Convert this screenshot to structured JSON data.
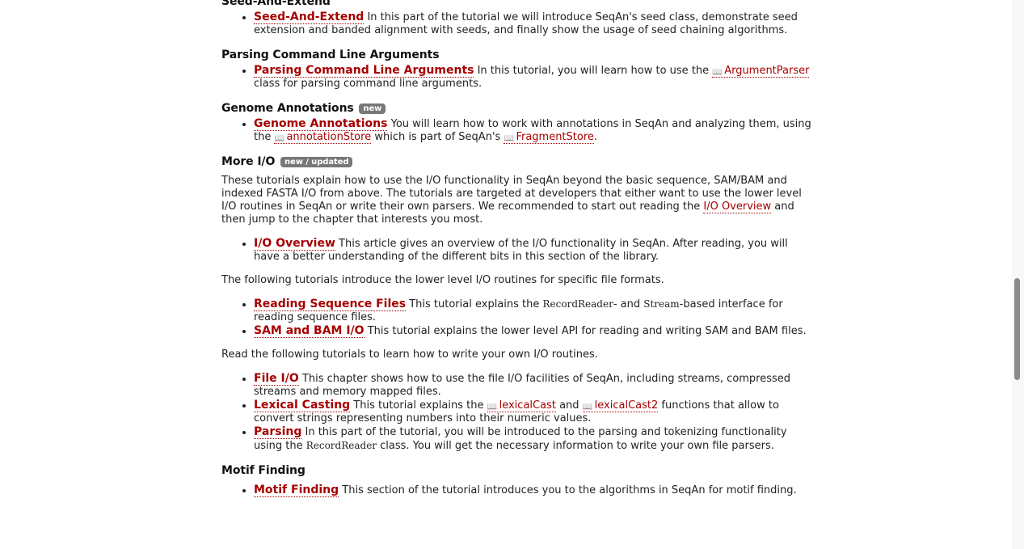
{
  "sections": {
    "seed": {
      "heading": "Seed-And-Extend",
      "item_link": "Seed-And-Extend",
      "item_text": " In this part of the tutorial we will introduce SeqAn's seed class, demonstrate seed extension and banded alignment with seeds, and finally show the usage of seed chaining algorithms."
    },
    "parsing_cli": {
      "heading": "Parsing Command Line Arguments",
      "item_link": "Parsing Command Line Arguments",
      "item_text_1": " In this tutorial, you will learn how to use the ",
      "dox_link": "ArgumentParser",
      "item_text_2": " class for parsing command line arguments."
    },
    "genome": {
      "heading": "Genome Annotations",
      "badge": "new",
      "item_link": "Genome Annotations",
      "item_text_1": " You will learn how to work with annotations in SeqAn and analyzing them, using the ",
      "dox_link_1": "annotationStore",
      "item_text_2": " which is part of SeqAn's ",
      "dox_link_2": "FragmentStore",
      "item_text_3": "."
    },
    "more_io": {
      "heading": "More I/O",
      "badge": "new / updated",
      "intro_1": "These tutorials explain how to use the I/O functionality in SeqAn beyond the basic sequence, SAM/BAM and indexed FASTA I/O from above. The tutorials are targeted at developers that either want to use the lower level I/O routines in SeqAn or write their own parsers. We recommended to start out reading the ",
      "intro_link": "I/O Overview",
      "intro_2": " and then jump to the chapter that interests you most.",
      "overview_link": "I/O Overview",
      "overview_text": " This article gives an overview of the I/O functionality in SeqAn. After reading, you will have a better understanding of the different bits in this section of the library.",
      "formats_intro": "The following tutorials introduce the lower level I/O routines for specific file formats.",
      "reading_link": "Reading Sequence Files",
      "reading_text_1": " This tutorial explains the ",
      "reading_code_1": "RecordReader",
      "reading_text_2": "- and ",
      "reading_code_2": "Stream",
      "reading_text_3": "-based interface for reading sequence files.",
      "sam_link": "SAM and BAM I/O",
      "sam_text": " This tutorial explains the lower level API for reading and writing SAM and BAM files.",
      "own_intro": "Read the following tutorials to learn how to write your own I/O routines.",
      "fileio_link": "File I/O",
      "fileio_text": " This chapter shows how to use the file I/O facilities of SeqAn, including streams, compressed streams and memory mapped files.",
      "lexical_link": "Lexical Casting",
      "lexical_text_1": " This tutorial explains the ",
      "lexical_dox_1": "lexicalCast",
      "lexical_text_2": " and ",
      "lexical_dox_2": "lexicalCast2",
      "lexical_text_3": " functions that allow to convert strings representing numbers into their numeric values.",
      "parsing_link": "Parsing",
      "parsing_text_1": " In this part of the tutorial, you will be introduced to the parsing and tokenizing functionality using the ",
      "parsing_code": "RecordReader",
      "parsing_text_2": " class. You will get the necessary information to write your own file parsers."
    },
    "motif": {
      "heading": "Motif Finding",
      "item_link": "Motif Finding",
      "item_text": " This section of the tutorial introduces you to the algorithms in SeqAn for motif finding."
    }
  },
  "icons": {
    "dox": "book-icon"
  }
}
